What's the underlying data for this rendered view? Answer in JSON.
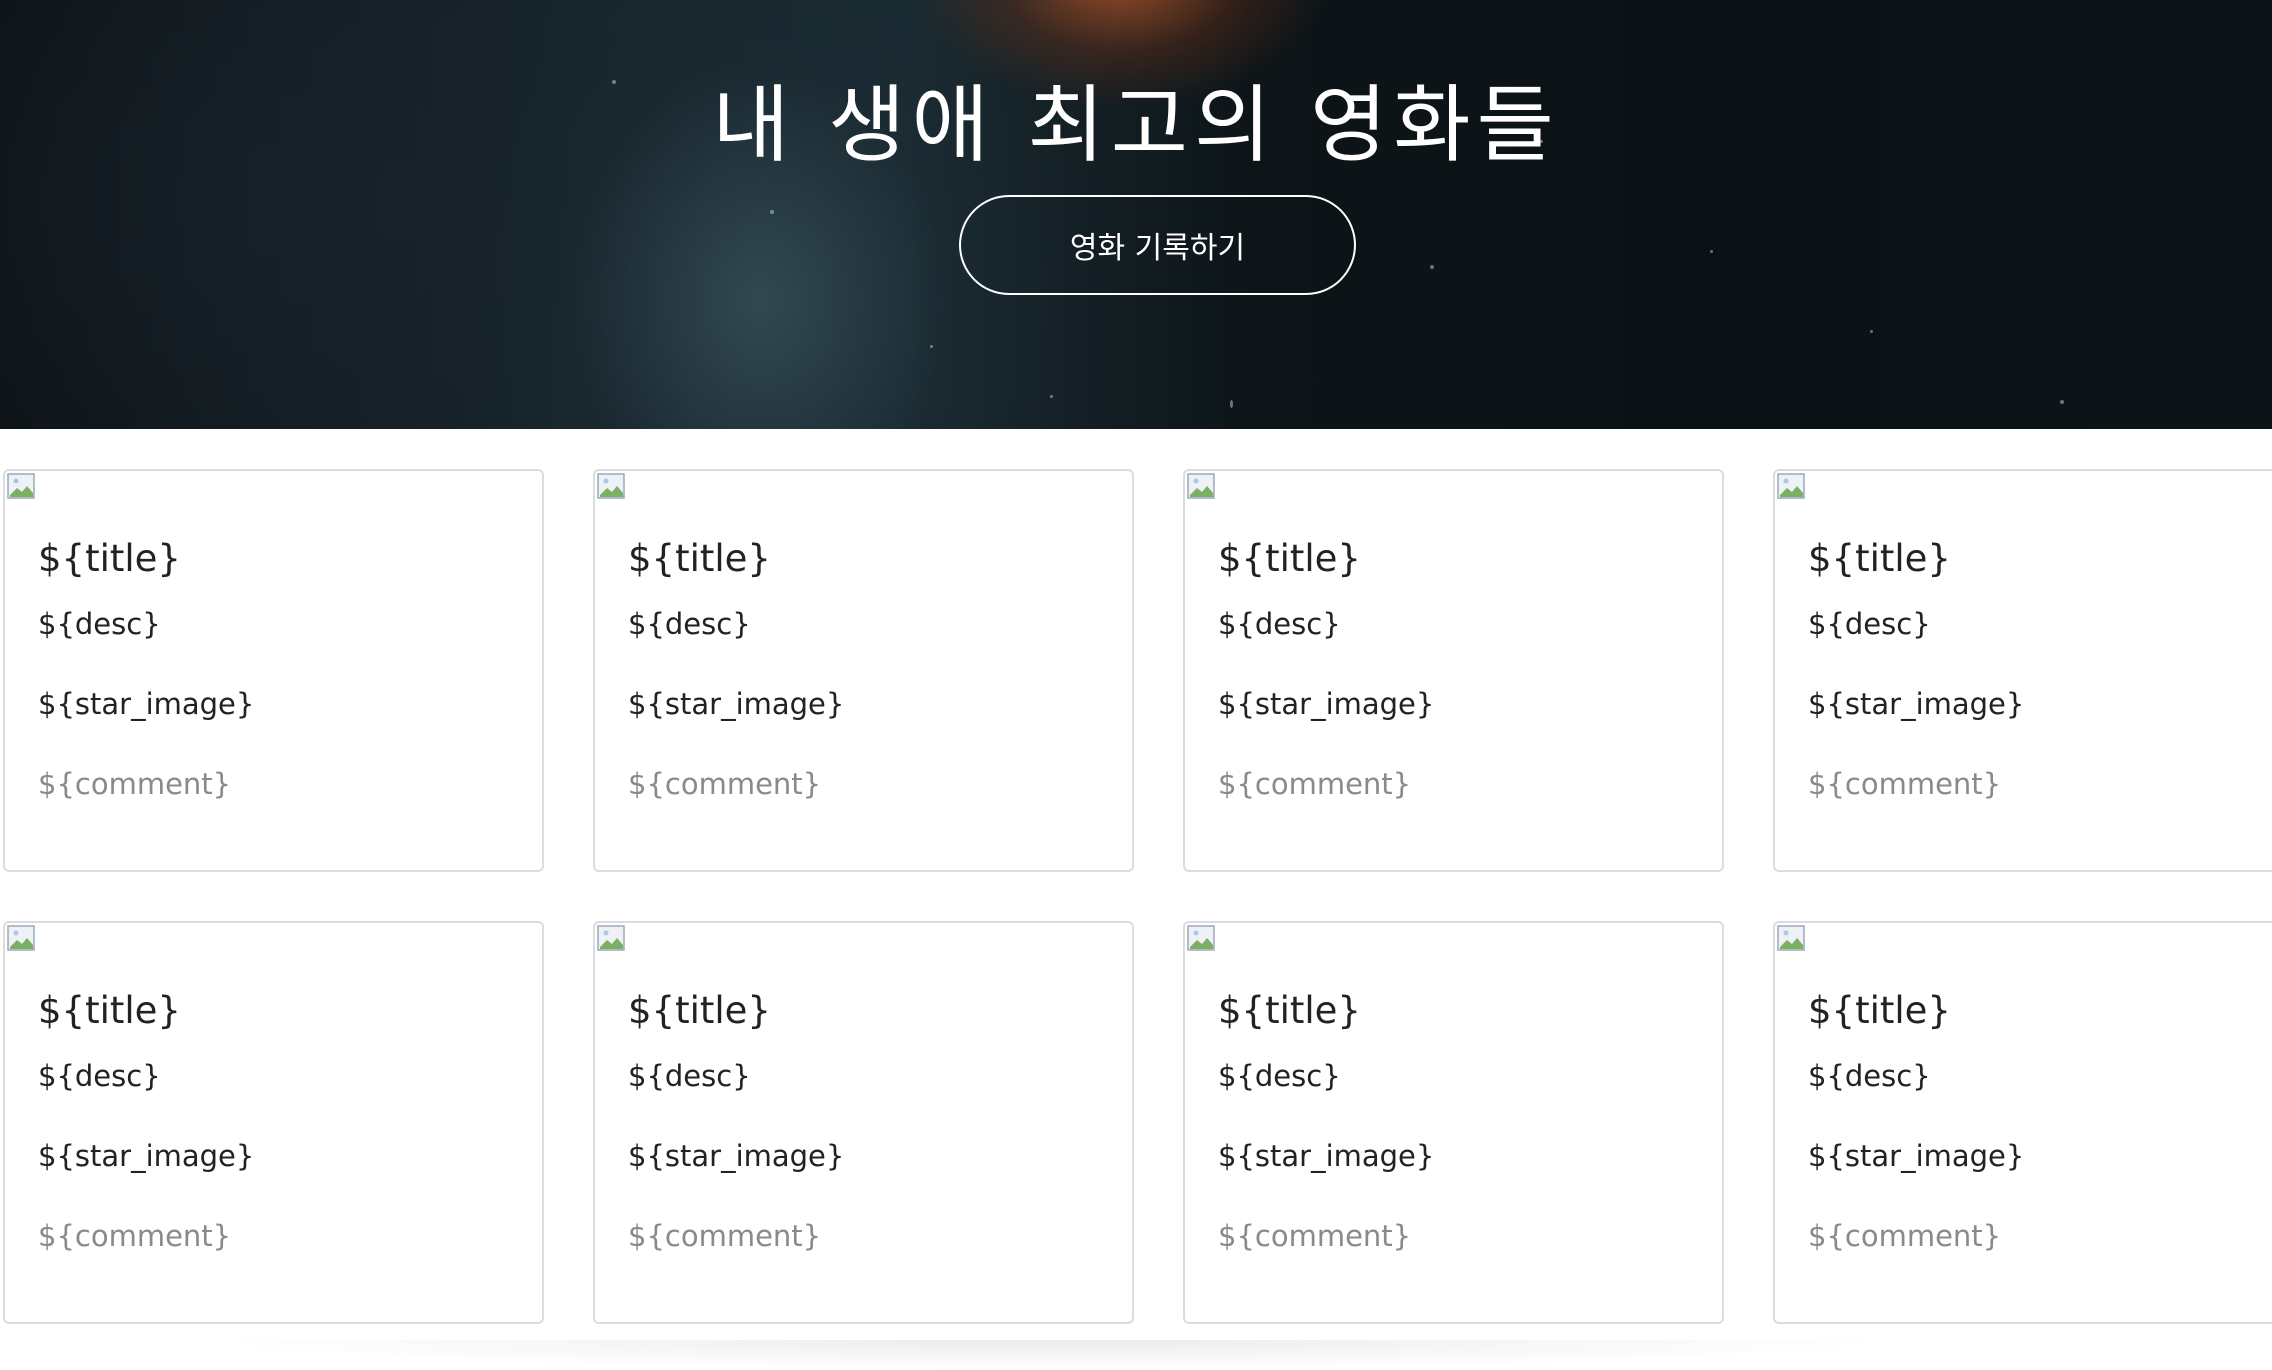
{
  "hero": {
    "title": "내 생애 최고의 영화들",
    "button_label": "영화 기록하기"
  },
  "cards": [
    {
      "title": "${title}",
      "desc": "${desc}",
      "star": "${star_image}",
      "comment": "${comment}"
    },
    {
      "title": "${title}",
      "desc": "${desc}",
      "star": "${star_image}",
      "comment": "${comment}"
    },
    {
      "title": "${title}",
      "desc": "${desc}",
      "star": "${star_image}",
      "comment": "${comment}"
    },
    {
      "title": "${title}",
      "desc": "${desc}",
      "star": "${star_image}",
      "comment": "${comment}"
    },
    {
      "title": "${title}",
      "desc": "${desc}",
      "star": "${star_image}",
      "comment": "${comment}"
    },
    {
      "title": "${title}",
      "desc": "${desc}",
      "star": "${star_image}",
      "comment": "${comment}"
    },
    {
      "title": "${title}",
      "desc": "${desc}",
      "star": "${star_image}",
      "comment": "${comment}"
    },
    {
      "title": "${title}",
      "desc": "${desc}",
      "star": "${star_image}",
      "comment": "${comment}"
    }
  ],
  "icons": {
    "broken_image": "broken-image-icon"
  },
  "colors": {
    "text_primary": "#222222",
    "text_muted": "#8a8a8a",
    "card_border": "#dcdcdc"
  }
}
